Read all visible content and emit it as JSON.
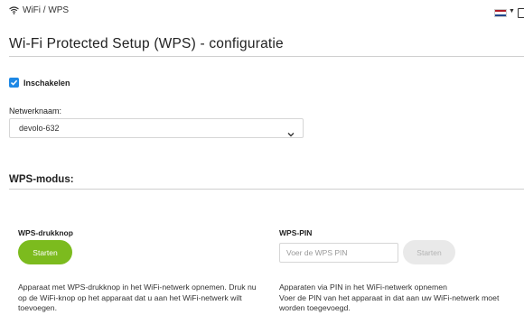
{
  "header": {
    "breadcrumb": "WiFi / WPS",
    "language_flag": [
      "#ae1c28",
      "#ffffff",
      "#21468b"
    ]
  },
  "page": {
    "title": "Wi-Fi Protected Setup (WPS) - configuratie"
  },
  "enable": {
    "label": "Inschakelen",
    "checked": true
  },
  "network": {
    "label": "Netwerknaam:",
    "selected": "devolo-632"
  },
  "wps_mode": {
    "heading": "WPS-modus:",
    "push_button": {
      "title": "WPS-drukknop",
      "button_label": "Starten",
      "description": "Apparaat met WPS-drukknop in het WiFi-netwerk opnemen. Druk nu op de WiFi-knop op het apparaat dat u aan het WiFi-netwerk wilt toevoegen."
    },
    "pin": {
      "title": "WPS-PIN",
      "placeholder": "Voer de WPS PIN",
      "button_label": "Starten",
      "description_line1": "Apparaten via PIN in het WiFi-netwerk opnemen",
      "description_line2": "Voer de PIN van het apparaat in dat aan uw WiFi-netwerk moet worden toegevoegd."
    }
  },
  "colors": {
    "accent_green": "#7cbb1e",
    "checkbox_blue": "#1e88e5",
    "disabled_button": "#e9e9e9"
  }
}
